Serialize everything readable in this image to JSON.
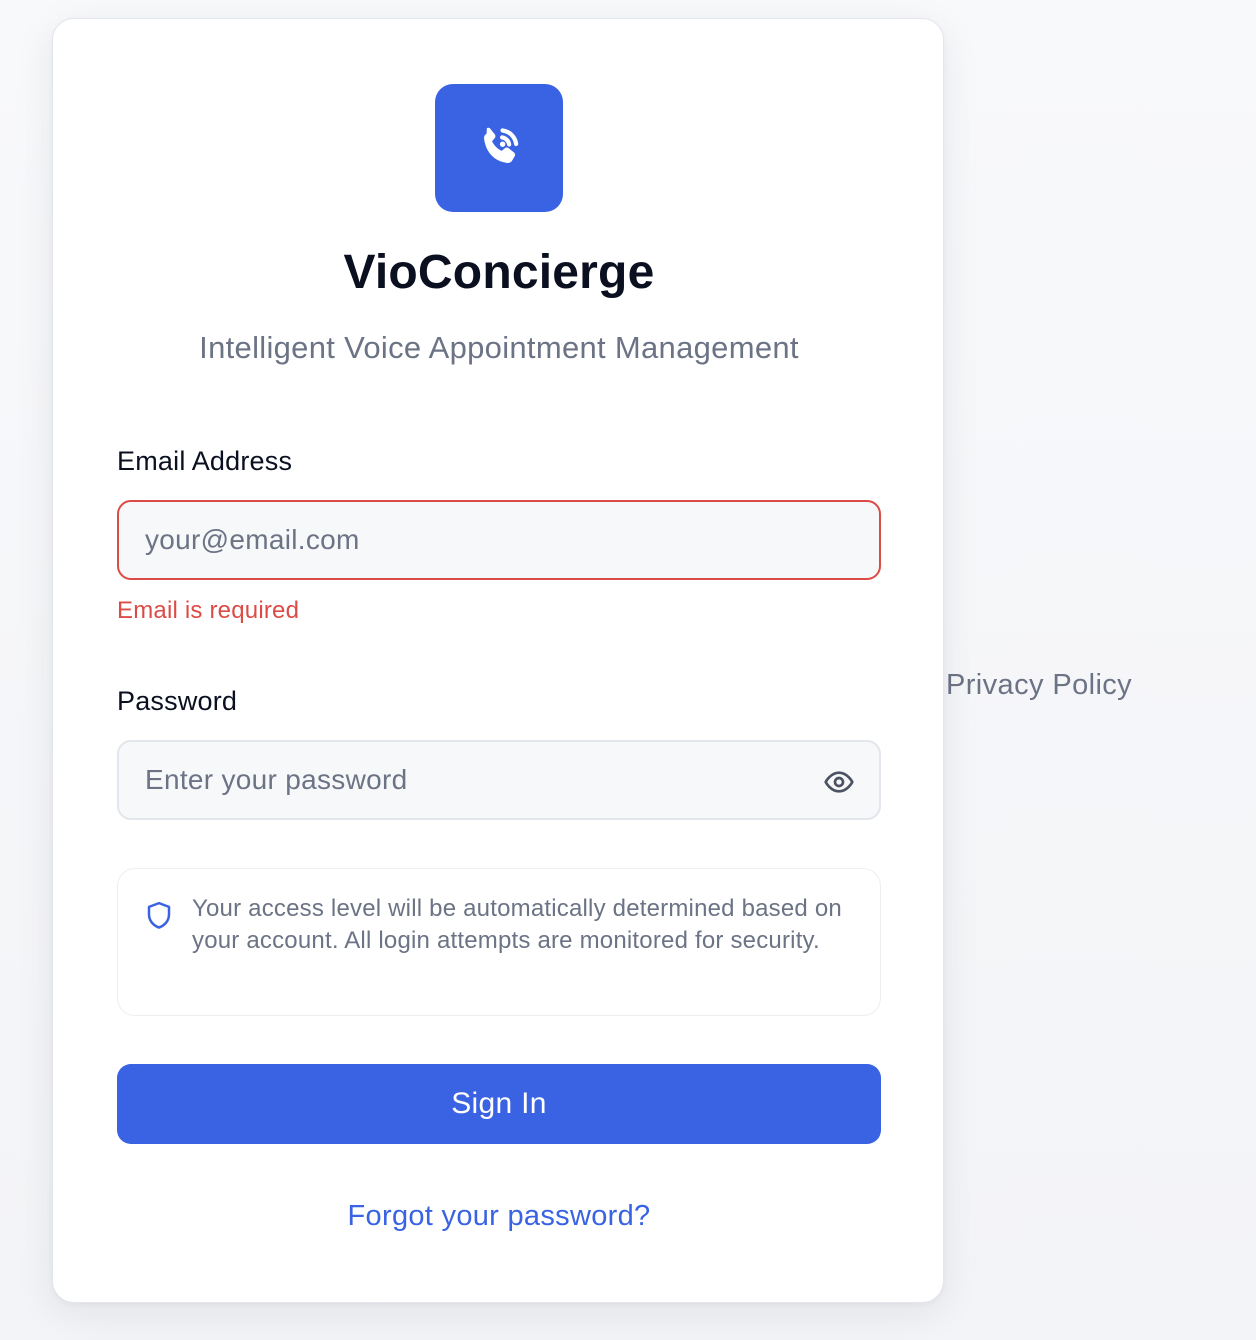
{
  "brand": {
    "name": "VioConcierge",
    "tagline": "Intelligent Voice Appointment Management",
    "accent_color": "#3a63e3",
    "logo_icon": "phone-call-icon"
  },
  "form": {
    "email": {
      "label": "Email Address",
      "placeholder": "your@email.com",
      "value": "",
      "error": "Email is required",
      "error_color": "#dc4c46"
    },
    "password": {
      "label": "Password",
      "placeholder": "Enter your password",
      "value": "",
      "toggle_icon": "eye-icon"
    },
    "notice": {
      "icon": "shield-icon",
      "text": "Your access level will be automatically determined based on your account. All login attempts are monitored for security."
    },
    "submit_label": "Sign In",
    "forgot_label": "Forgot your password?"
  },
  "footer": {
    "privacy_label": "Privacy Policy"
  }
}
